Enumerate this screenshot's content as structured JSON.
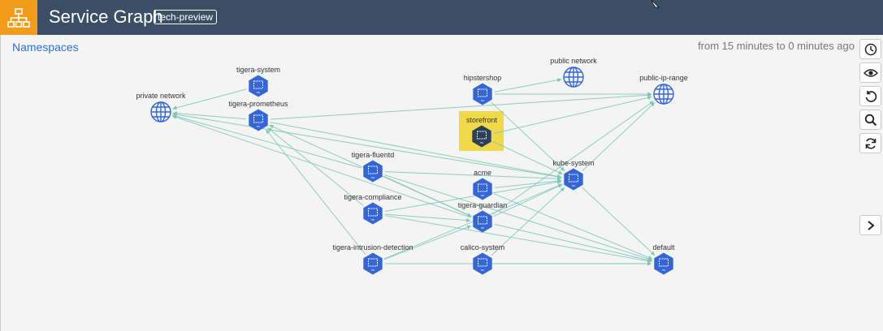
{
  "header": {
    "title": "Service Graph",
    "badge": "tech-preview",
    "logo_icon": "hierarchy-icon",
    "bg_color": "#3a4f66",
    "logo_color": "#f39c19"
  },
  "breadcrumb": {
    "namespaces_label": "Namespaces"
  },
  "time_range": "from 15 minutes to 0 minutes ago",
  "toolbar": [
    {
      "name": "history-button",
      "icon": "clock-icon"
    },
    {
      "name": "view-button",
      "icon": "eye-icon"
    },
    {
      "name": "undo-button",
      "icon": "undo-icon"
    },
    {
      "name": "search-button",
      "icon": "search-icon"
    },
    {
      "name": "refresh-button",
      "icon": "refresh-icon"
    }
  ],
  "side_panel": {
    "expand_icon": "chevron-right-icon"
  },
  "graph": {
    "selected_node": "storefront",
    "selection_color": "#efd948",
    "node_color": "#3466d8",
    "selected_node_color": "#2b3e5a",
    "edge_color": "#7bc7b4",
    "nodes": [
      {
        "id": "tigera-system",
        "label": "tigera-system",
        "kind": "namespace"
      },
      {
        "id": "private-network",
        "label": "private network",
        "kind": "network"
      },
      {
        "id": "tigera-prometheus",
        "label": "tigera-prometheus",
        "kind": "namespace"
      },
      {
        "id": "hipstershop",
        "label": "hipstershop",
        "kind": "namespace"
      },
      {
        "id": "public-network",
        "label": "public network",
        "kind": "network"
      },
      {
        "id": "public-ip-range",
        "label": "public-ip-range",
        "kind": "network"
      },
      {
        "id": "storefront",
        "label": "storefront",
        "kind": "namespace"
      },
      {
        "id": "tigera-fluentd",
        "label": "tigera-fluentd",
        "kind": "namespace"
      },
      {
        "id": "kube-system",
        "label": "kube-system",
        "kind": "namespace"
      },
      {
        "id": "acme",
        "label": "acme",
        "kind": "namespace"
      },
      {
        "id": "tigera-compliance",
        "label": "tigera-compliance",
        "kind": "namespace"
      },
      {
        "id": "tigera-guardian",
        "label": "tigera-guardian",
        "kind": "namespace"
      },
      {
        "id": "tigera-intrusion-detection",
        "label": "tigera-intrusion-detection",
        "kind": "namespace"
      },
      {
        "id": "calico-system",
        "label": "calico-system",
        "kind": "namespace"
      },
      {
        "id": "default",
        "label": "default",
        "kind": "namespace"
      }
    ],
    "edges": [
      [
        "tigera-system",
        "private-network"
      ],
      [
        "tigera-prometheus",
        "private-network"
      ],
      [
        "tigera-fluentd",
        "private-network"
      ],
      [
        "tigera-guardian",
        "private-network"
      ],
      [
        "kube-system",
        "private-network"
      ],
      [
        "tigera-compliance",
        "tigera-prometheus"
      ],
      [
        "tigera-intrusion-detection",
        "tigera-prometheus"
      ],
      [
        "tigera-guardian",
        "tigera-prometheus"
      ],
      [
        "tigera-prometheus",
        "kube-system"
      ],
      [
        "tigera-prometheus",
        "public-ip-range"
      ],
      [
        "hipstershop",
        "public-network"
      ],
      [
        "hipstershop",
        "public-ip-range"
      ],
      [
        "storefront",
        "public-ip-range"
      ],
      [
        "storefront",
        "kube-system"
      ],
      [
        "kube-system",
        "public-ip-range"
      ],
      [
        "hipstershop",
        "kube-system"
      ],
      [
        "tigera-fluentd",
        "kube-system"
      ],
      [
        "tigera-fluentd",
        "tigera-guardian"
      ],
      [
        "tigera-fluentd",
        "default"
      ],
      [
        "acme",
        "kube-system"
      ],
      [
        "acme",
        "default"
      ],
      [
        "tigera-compliance",
        "kube-system"
      ],
      [
        "tigera-compliance",
        "tigera-guardian"
      ],
      [
        "tigera-compliance",
        "default"
      ],
      [
        "tigera-guardian",
        "kube-system"
      ],
      [
        "tigera-guardian",
        "default"
      ],
      [
        "tigera-guardian",
        "public-ip-range"
      ],
      [
        "tigera-intrusion-detection",
        "tigera-guardian"
      ],
      [
        "tigera-intrusion-detection",
        "kube-system"
      ],
      [
        "tigera-intrusion-detection",
        "default"
      ],
      [
        "calico-system",
        "default"
      ],
      [
        "calico-system",
        "kube-system"
      ],
      [
        "kube-system",
        "default"
      ]
    ]
  }
}
